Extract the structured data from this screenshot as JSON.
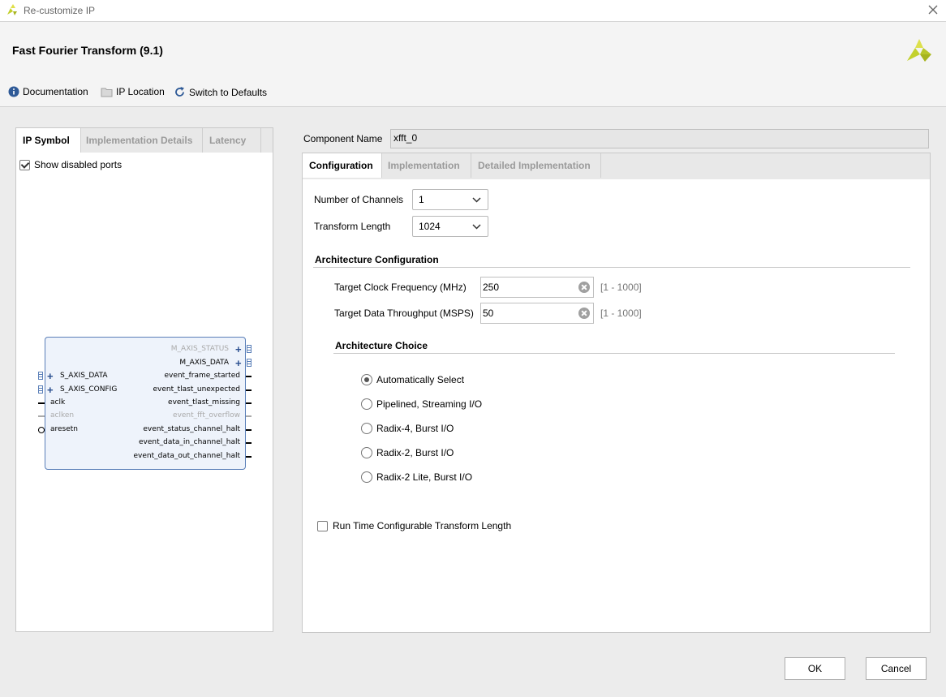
{
  "window": {
    "title": "Re-customize IP"
  },
  "header": {
    "title": "Fast Fourier Transform (9.1)"
  },
  "toolbar": {
    "documentation": "Documentation",
    "ip_location": "IP Location",
    "switch_defaults": "Switch to Defaults"
  },
  "left_tabs": [
    "IP Symbol",
    "Implementation Details",
    "Latency"
  ],
  "show_disabled": "Show disabled ports",
  "symbol": {
    "left_ports": [
      "S_AXIS_DATA",
      "S_AXIS_CONFIG",
      "aclk",
      "aclken",
      "aresetn"
    ],
    "right_ports": [
      "M_AXIS_STATUS",
      "M_AXIS_DATA",
      "event_frame_started",
      "event_tlast_unexpected",
      "event_tlast_missing",
      "event_fft_overflow",
      "event_status_channel_halt",
      "event_data_in_channel_halt",
      "event_data_out_channel_halt"
    ]
  },
  "component": {
    "label": "Component Name",
    "value": "xfft_0"
  },
  "right_tabs": [
    "Configuration",
    "Implementation",
    "Detailed Implementation"
  ],
  "config": {
    "channels_label": "Number of Channels",
    "channels_value": "1",
    "length_label": "Transform Length",
    "length_value": "1024",
    "arch_config": "Architecture Configuration",
    "clock_label": "Target Clock Frequency (MHz)",
    "clock_value": "250",
    "clock_range": "[1 - 1000]",
    "throughput_label": "Target Data Throughput (MSPS)",
    "throughput_value": "50",
    "throughput_range": "[1 - 1000]",
    "arch_choice": "Architecture Choice",
    "choices": [
      "Automatically Select",
      "Pipelined, Streaming I/O",
      "Radix-4, Burst I/O",
      "Radix-2, Burst I/O",
      "Radix-2 Lite, Burst I/O"
    ],
    "runtime": "Run Time Configurable Transform Length"
  },
  "buttons": {
    "ok": "OK",
    "cancel": "Cancel"
  }
}
